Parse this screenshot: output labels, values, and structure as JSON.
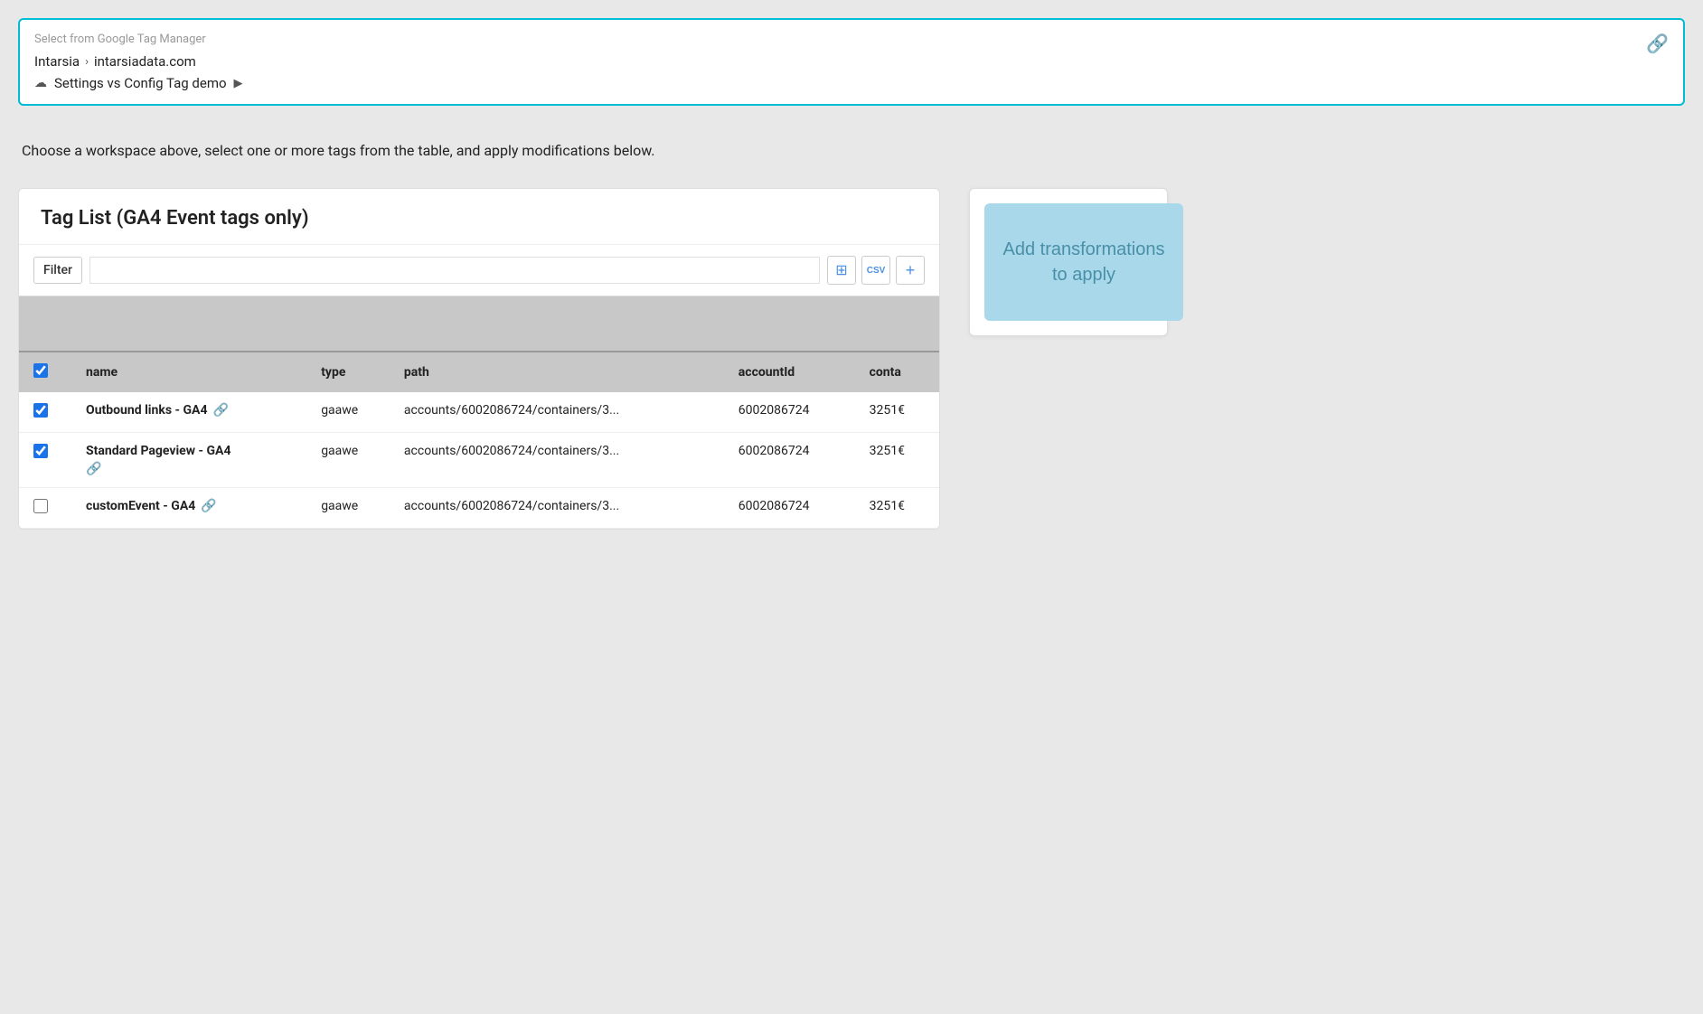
{
  "gtm_selector": {
    "placeholder": "Select from Google Tag Manager",
    "link_icon": "🔗",
    "breadcrumb": {
      "account": "Intarsia",
      "chevron": "›",
      "property": "intarsiadata.com"
    },
    "workspace": {
      "ws_icon": "☁",
      "name": "Settings vs Config Tag demo",
      "play_icon": "▶"
    }
  },
  "instruction": "Choose a workspace above, select one or more tags from the table, and apply modifications below.",
  "tag_list": {
    "title": "Tag List (GA4 Event tags only)",
    "filter_label": "Filter",
    "filter_placeholder": "",
    "icons": {
      "grid": "⊞",
      "csv": "csv",
      "add": "+"
    },
    "columns": [
      {
        "key": "checkbox",
        "label": ""
      },
      {
        "key": "name",
        "label": "name"
      },
      {
        "key": "type",
        "label": "type"
      },
      {
        "key": "path",
        "label": "path"
      },
      {
        "key": "accountId",
        "label": "accountId"
      },
      {
        "key": "conta",
        "label": "conta"
      }
    ],
    "rows": [
      {
        "checked": true,
        "name": "Outbound links - GA4",
        "has_link": true,
        "link_position": "inline",
        "type": "gaawe",
        "path": "accounts/6002086724/containers/3...",
        "accountId": "6002086724",
        "conta": "3251€"
      },
      {
        "checked": true,
        "name": "Standard Pageview - GA4",
        "has_link": true,
        "link_position": "below",
        "type": "gaawe",
        "path": "accounts/6002086724/containers/3...",
        "accountId": "6002086724",
        "conta": "3251€"
      },
      {
        "checked": false,
        "name": "customEvent - GA4",
        "has_link": true,
        "link_position": "inline",
        "type": "gaawe",
        "path": "accounts/6002086724/containers/3...",
        "accountId": "6002086724",
        "conta": "3251€"
      }
    ]
  },
  "transformations": {
    "button_label": "Add transformations to apply"
  }
}
